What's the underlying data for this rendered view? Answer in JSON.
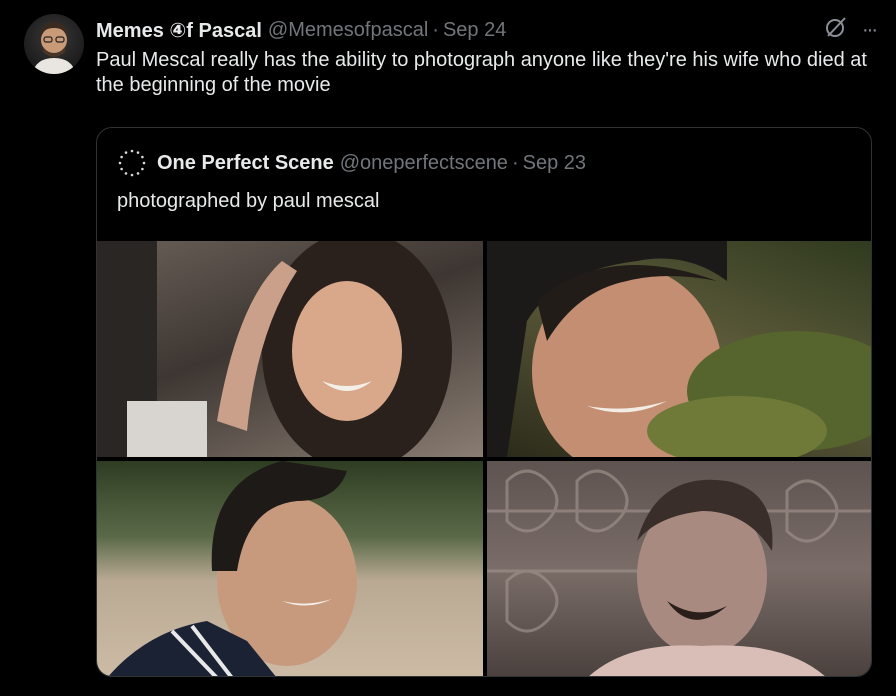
{
  "tweet": {
    "display_name": "Memes ④f Pascal",
    "handle": "@Memesofpascal",
    "separator": "·",
    "date": "Sep 24",
    "text": "Paul Mescal really has the ability to photograph anyone like they're his wife who died at the beginning of the movie",
    "more_label": "···"
  },
  "quoted_tweet": {
    "display_name": "One Perfect Scene",
    "handle": "@oneperfectscene",
    "separator": "·",
    "date": "Sep 23",
    "text": "photographed by paul mescal"
  },
  "icons": {
    "grok": "grok-icon",
    "more": "more-icon",
    "quoted_avatar": "one-perfect-scene-logo"
  },
  "colors": {
    "background": "#000000",
    "primary_text": "#e7e9ea",
    "secondary_text": "#71767b",
    "border": "#2f3336"
  }
}
